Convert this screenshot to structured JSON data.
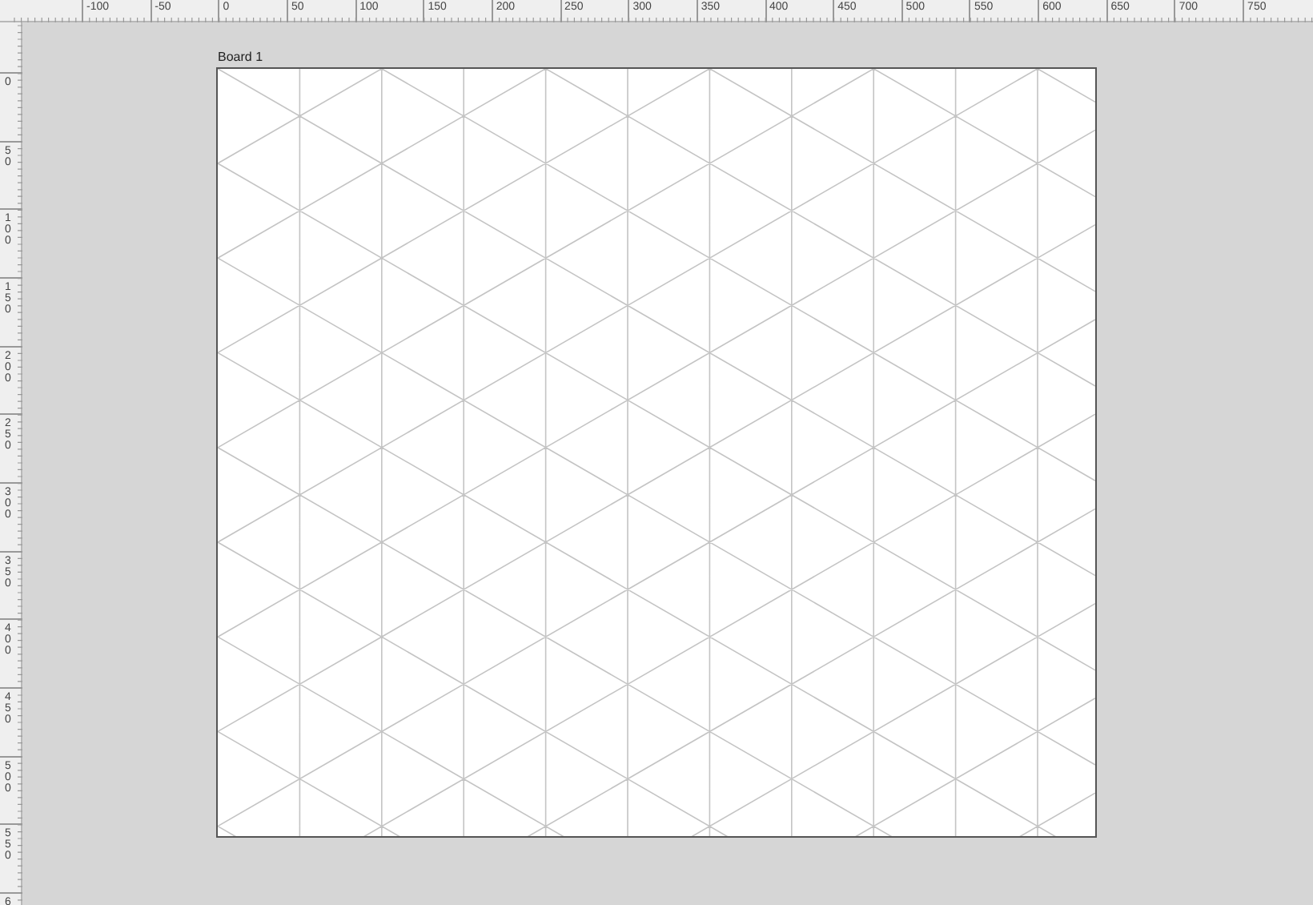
{
  "top_ruler": {
    "labels": [
      "-100",
      "-50",
      "0",
      "50",
      "100",
      "150",
      "200",
      "250",
      "300",
      "350",
      "400",
      "450",
      "500",
      "550",
      "600",
      "650",
      "700",
      "750"
    ]
  },
  "left_ruler": {
    "labels": [
      "0",
      "50",
      "100",
      "150",
      "200",
      "250",
      "300",
      "350",
      "400",
      "450",
      "500",
      "550",
      "6"
    ]
  },
  "board": {
    "title": "Board 1"
  }
}
